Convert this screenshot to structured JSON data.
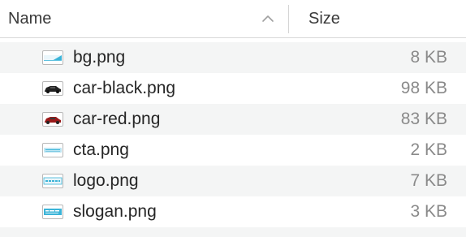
{
  "header": {
    "name_label": "Name",
    "size_label": "Size",
    "sort_icon": "chevron-up-icon"
  },
  "files": [
    {
      "name": "bg.png",
      "size": "8 KB",
      "icon": "bg-thumbnail-icon"
    },
    {
      "name": "car-black.png",
      "size": "98 KB",
      "icon": "car-black-thumbnail-icon"
    },
    {
      "name": "car-red.png",
      "size": "83 KB",
      "icon": "car-red-thumbnail-icon"
    },
    {
      "name": "cta.png",
      "size": "2 KB",
      "icon": "cta-thumbnail-icon"
    },
    {
      "name": "logo.png",
      "size": "7 KB",
      "icon": "logo-thumbnail-icon"
    },
    {
      "name": "slogan.png",
      "size": "3 KB",
      "icon": "slogan-thumbnail-icon"
    }
  ],
  "colors": {
    "alt_row": "#f4f5f5",
    "accent_cyan": "#3bb4d8"
  }
}
